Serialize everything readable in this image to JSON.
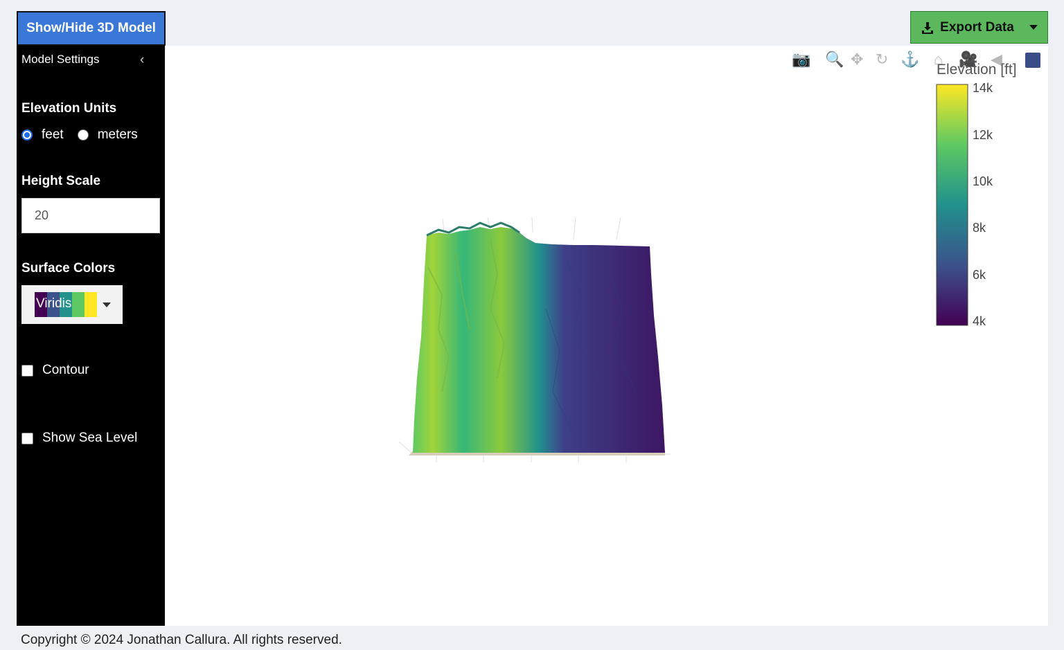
{
  "header": {
    "toggle_button": "Show/Hide 3D Model",
    "export_button": "Export Data"
  },
  "sidebar": {
    "title": "Model Settings",
    "chevron": "‹",
    "elevation_units": {
      "label": "Elevation Units",
      "options": [
        "feet",
        "meters"
      ],
      "selected": "feet"
    },
    "height_scale": {
      "label": "Height Scale",
      "value": "20"
    },
    "surface_colors": {
      "label": "Surface Colors",
      "selected": "Viridis"
    },
    "contour": {
      "label": "Contour",
      "checked": false
    },
    "sea_level": {
      "label": "Show Sea Level",
      "checked": false
    }
  },
  "plot": {
    "colorbar": {
      "title": "Elevation [ft]",
      "ticks": [
        "14k",
        "12k",
        "10k",
        "8k",
        "6k",
        "4k"
      ]
    },
    "modebar_icons": [
      "camera-icon",
      "zoom-icon",
      "pan-icon",
      "orbit-rotation-icon",
      "turntable-rotation-icon",
      "home-icon",
      "camera-reset-icon",
      "hover-toggle-icon",
      "plotly-logo-icon"
    ]
  },
  "footer": {
    "copyright": "Copyright © 2024 Jonathan Callura. All rights reserved."
  },
  "colors": {
    "toggle_bg": "#3a78d8",
    "export_bg": "#5cb85c",
    "viridis": [
      "#440154",
      "#3b528b",
      "#21918c",
      "#5ec962",
      "#fde725"
    ]
  }
}
